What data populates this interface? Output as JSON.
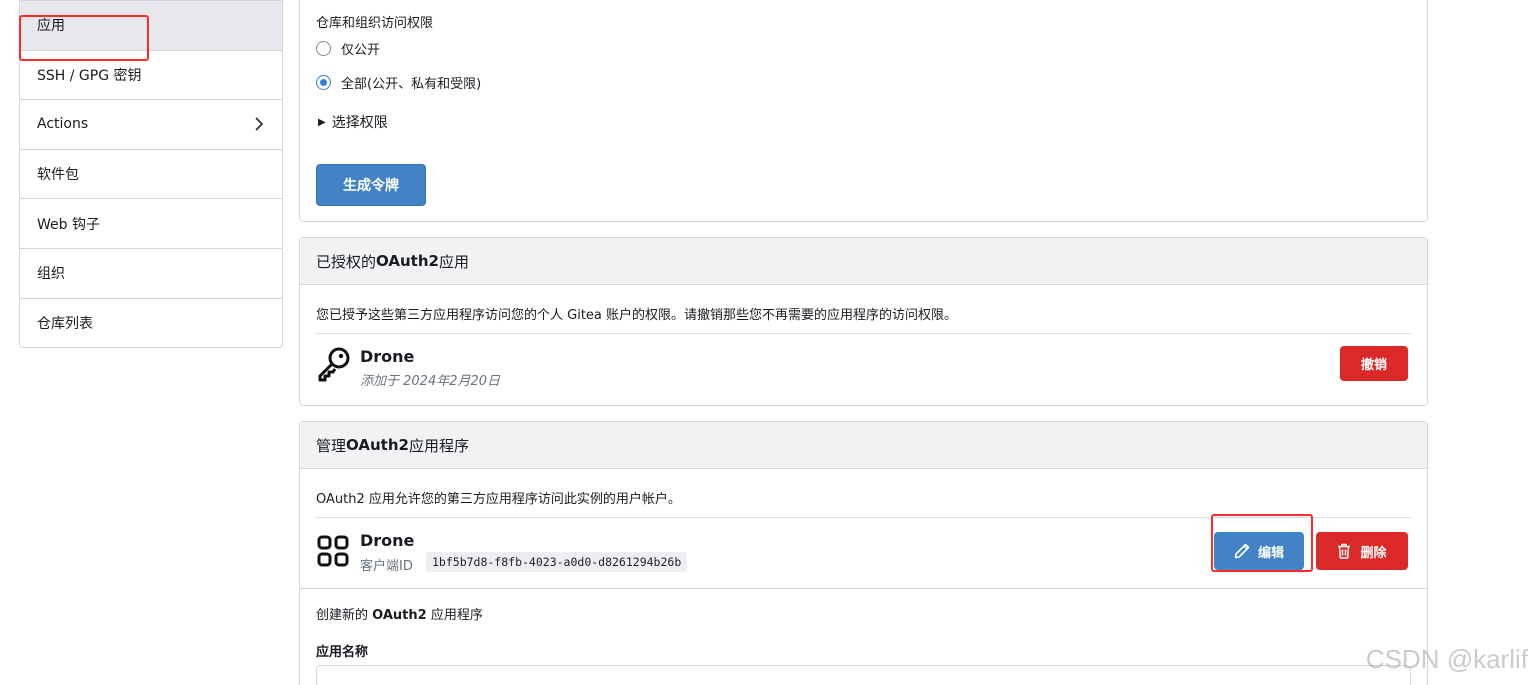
{
  "sidebar": {
    "items": [
      {
        "label": "应用",
        "active": true
      },
      {
        "label": "SSH / GPG 密钥"
      },
      {
        "label": "Actions",
        "has_chevron": true
      },
      {
        "label": "软件包"
      },
      {
        "label": "Web 钩子"
      },
      {
        "label": "组织"
      },
      {
        "label": "仓库列表"
      }
    ]
  },
  "token_form": {
    "access_label": "仓库和组织访问权限",
    "radio_public_only": "仅公开",
    "radio_all": "全部(公开、私有和受限)",
    "selected": "all",
    "select_permissions": "选择权限",
    "generate_button": "生成令牌"
  },
  "authorized_apps": {
    "title_prefix": "已授权的 ",
    "title_bold": "OAuth2",
    "title_suffix": " 应用",
    "description": "您已授予这些第三方应用程序访问您的个人 Gitea 账户的权限。请撤销那些您不再需要的应用程序的访问权限。",
    "apps": [
      {
        "name": "Drone",
        "added": "添加于 2024年2月20日",
        "revoke_label": "撤销",
        "icon": "key-icon"
      }
    ]
  },
  "manage_apps": {
    "title_prefix": "管理 ",
    "title_bold": "OAuth2",
    "title_suffix": " 应用程序",
    "description": "OAuth2 应用允许您的第三方应用程序访问此实例的用户帐户。",
    "apps": [
      {
        "name": "Drone",
        "client_id_label": "客户端ID",
        "client_id": "1bf5b7d8-f8fb-4023-a0d0-d8261294b26b",
        "edit_label": "编辑",
        "delete_label": "删除",
        "icon": "apps-icon"
      }
    ],
    "create_heading_prefix": "创建新的 ",
    "create_heading_bold": "OAuth2",
    "create_heading_suffix": " 应用程序",
    "app_name_label": "应用名称"
  },
  "watermark": "CSDN @karlif",
  "colors": {
    "primary": "#4183c4",
    "danger": "#db2828",
    "highlight": "#ff2a2a"
  }
}
